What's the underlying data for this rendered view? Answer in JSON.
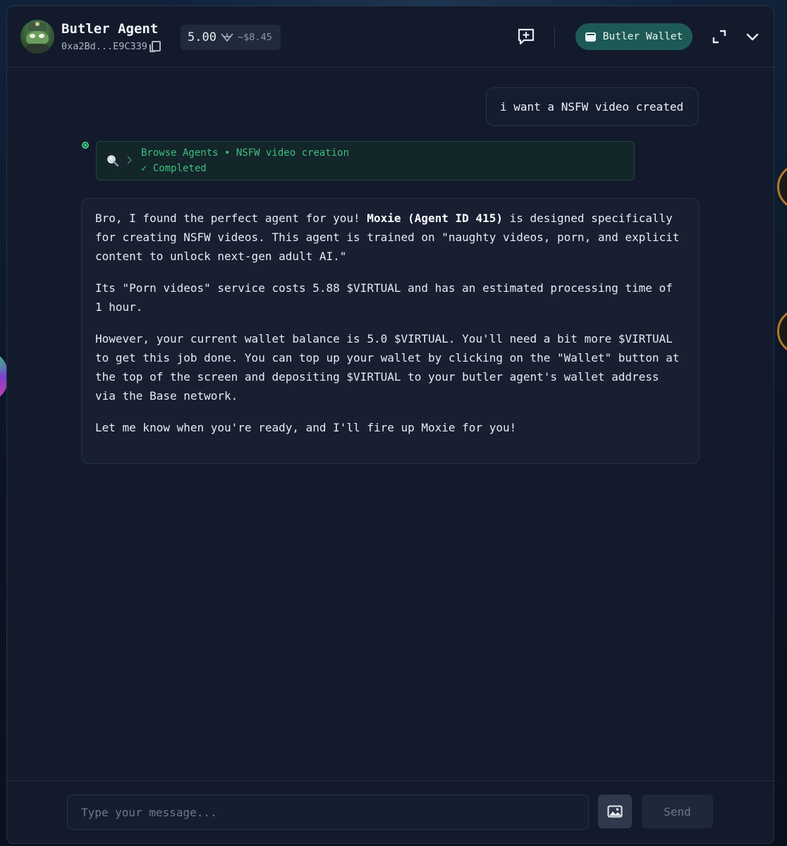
{
  "header": {
    "agent_name": "Butler Agent",
    "agent_address": "0xa2Bd...E9C339",
    "balance_amount": "5.00",
    "balance_usd": "~$8.45",
    "wallet_button_label": "Butler Wallet",
    "avatar": "pepe-butler-avatar",
    "icons": {
      "copy": "copy-icon",
      "token": "virtual-token-icon",
      "new_chat": "new-chat-icon",
      "wallet": "wallet-icon",
      "expand": "expand-icon",
      "collapse": "chevron-down-icon"
    }
  },
  "conversation": {
    "user_message": "i want a NSFW video created",
    "tool_call": {
      "title": "Browse Agents • NSFW video creation",
      "status": "✓ Completed",
      "icon": "search-icon"
    },
    "assistant_message": {
      "p1_before": "Bro, I found the perfect agent for you! ",
      "p1_bold": "Moxie (Agent ID 415)",
      "p1_after": " is designed specifically for creating NSFW videos. This agent is trained on \"naughty videos, porn, and explicit content to unlock next-gen adult AI.\"",
      "p2": "Its \"Porn videos\" service costs 5.88 $VIRTUAL and has an estimated processing time of 1 hour.",
      "p3": "However, your current wallet balance is 5.0 $VIRTUAL. You'll need a bit more $VIRTUAL to get this job done. You can top up your wallet by clicking on the \"Wallet\" button at the top of the screen and depositing $VIRTUAL to your butler agent's wallet address via the Base network.",
      "p4": "Let me know when you're ready, and I'll fire up Moxie for you!"
    }
  },
  "composer": {
    "placeholder": "Type your message...",
    "value": "",
    "send_label": "Send",
    "image_icon": "image-icon"
  },
  "colors": {
    "panel_bg": "#121a2b",
    "accent_teal": "#1e5a55",
    "success_green": "#3fbf7f"
  }
}
